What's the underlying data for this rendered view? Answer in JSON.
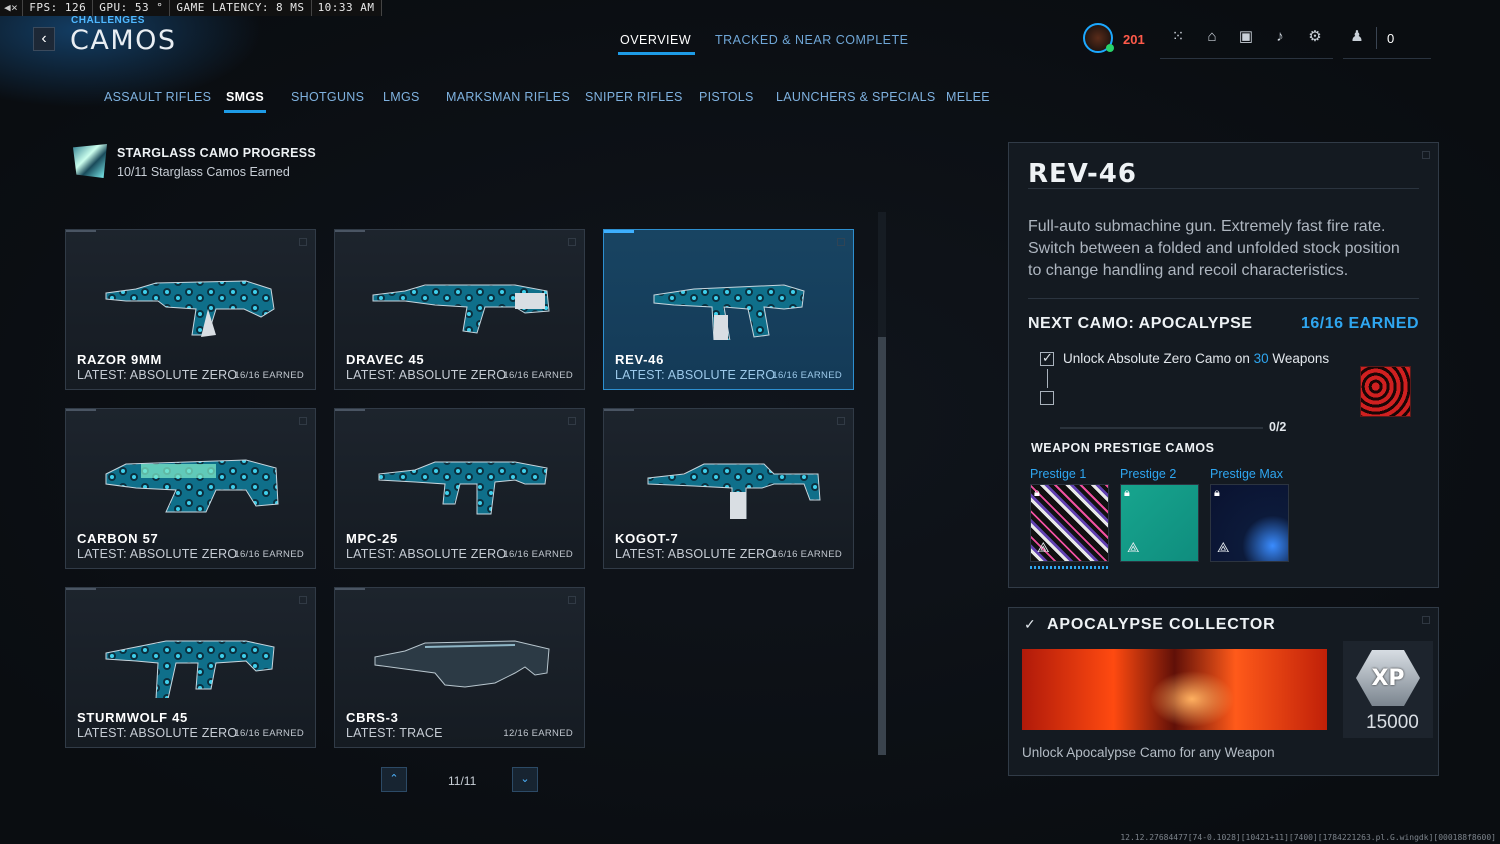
{
  "perf": {
    "speaker": "◀×",
    "fps": "FPS: 126",
    "gpu": "GPU: 53 °",
    "latency": "GAME LATENCY:  8 MS",
    "time": "10:33 AM"
  },
  "header": {
    "crumb": "CHALLENGES",
    "title": "CAMOS",
    "back": "‹",
    "tabs": [
      {
        "label": "OVERVIEW"
      },
      {
        "label": "TRACKED & NEAR COMPLETE"
      }
    ],
    "cp": "201",
    "count": "0"
  },
  "categories": [
    "ASSAULT RIFLES",
    "SMGS",
    "SHOTGUNS",
    "LMGS",
    "MARKSMAN RIFLES",
    "SNIPER RIFLES",
    "PISTOLS",
    "LAUNCHERS & SPECIALS",
    "MELEE"
  ],
  "progress": {
    "title": "STARGLASS CAMO PROGRESS",
    "sub": "10/11 Starglass Camos Earned"
  },
  "weapons": [
    {
      "name": "RAZOR 9MM",
      "latest": "LATEST: ABSOLUTE ZERO",
      "earned": "16/16 EARNED"
    },
    {
      "name": "DRAVEC 45",
      "latest": "LATEST: ABSOLUTE ZERO",
      "earned": "16/16 EARNED"
    },
    {
      "name": "REV-46",
      "latest": "LATEST: ABSOLUTE ZERO",
      "earned": "16/16 EARNED"
    },
    {
      "name": "CARBON 57",
      "latest": "LATEST: ABSOLUTE ZERO",
      "earned": "16/16 EARNED"
    },
    {
      "name": "MPC-25",
      "latest": "LATEST: ABSOLUTE ZERO",
      "earned": "16/16 EARNED"
    },
    {
      "name": "KOGOT-7",
      "latest": "LATEST: ABSOLUTE ZERO",
      "earned": "16/16 EARNED"
    },
    {
      "name": "STURMWOLF 45",
      "latest": "LATEST: ABSOLUTE ZERO",
      "earned": "16/16 EARNED"
    },
    {
      "name": "CBRS-3",
      "latest": "LATEST: TRACE",
      "earned": "12/16 EARNED"
    }
  ],
  "pager": {
    "text": "11/11",
    "up": "⌃",
    "down": "⌄"
  },
  "detail": {
    "title": "REV-46",
    "desc": "Full-auto submachine gun. Extremely fast fire rate. Switch between a folded and unfolded stock position to change handling and recoil characteristics.",
    "next_label": "NEXT CAMO: APOCALYPSE",
    "next_earned": "16/16 EARNED",
    "req_prefix": "Unlock Absolute Zero Camo on ",
    "req_num": "30",
    "req_suffix": " Weapons",
    "req_progress": "0/2",
    "prestige_title": "WEAPON PRESTIGE CAMOS",
    "prestige": [
      "Prestige 1",
      "Prestige 2",
      "Prestige Max"
    ]
  },
  "reward": {
    "title": "APOCALYPSE COLLECTOR",
    "xp_badge": "XP",
    "xp": "15000",
    "desc": "Unlock Apocalypse Camo for any Weapon"
  },
  "footer": "12.12.27684477[74-0.1028][10421+11][7400][1784221263.pl.G.wingdk][000188f8600]",
  "colors": {
    "accent": "#1e9be6",
    "cp": "#ff5a4a"
  }
}
